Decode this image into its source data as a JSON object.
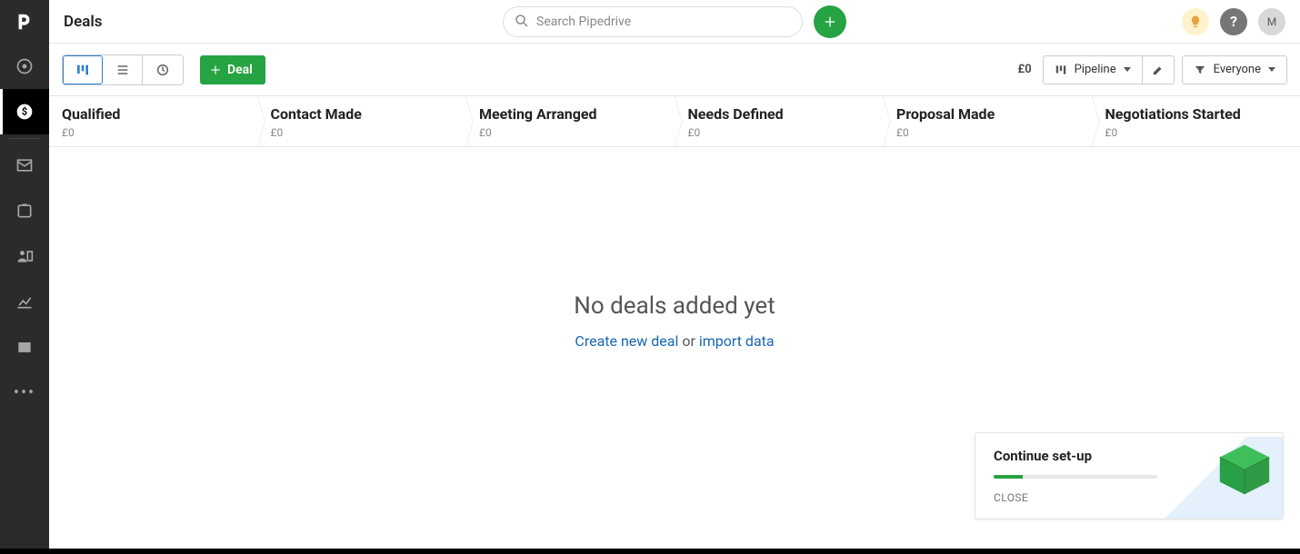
{
  "header": {
    "page_title": "Deals",
    "search_placeholder": "Search Pipedrive",
    "avatar_initial": "M"
  },
  "toolbar": {
    "add_deal_label": "Deal",
    "total_amount": "£0",
    "pipeline_label": "Pipeline",
    "everyone_label": "Everyone"
  },
  "pipeline_stages": [
    {
      "title": "Qualified",
      "amount": "£0"
    },
    {
      "title": "Contact Made",
      "amount": "£0"
    },
    {
      "title": "Meeting Arranged",
      "amount": "£0"
    },
    {
      "title": "Needs Defined",
      "amount": "£0"
    },
    {
      "title": "Proposal Made",
      "amount": "£0"
    },
    {
      "title": "Negotiations Started",
      "amount": "£0"
    }
  ],
  "empty_state": {
    "heading": "No deals added yet",
    "create_link": "Create new deal",
    "or_text": " or ",
    "import_link": "import data"
  },
  "setup_widget": {
    "title": "Continue set-up",
    "close_label": "CLOSE"
  }
}
